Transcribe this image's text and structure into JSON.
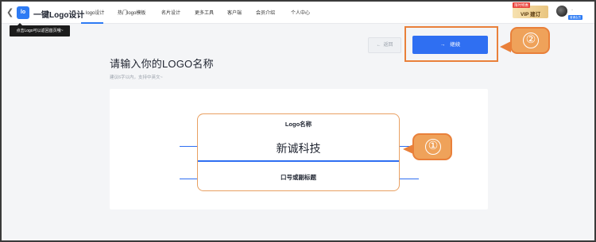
{
  "nav": {
    "brand": "一键Logo设计",
    "items": [
      "logo设计",
      "热门logo模板",
      "名片设计",
      "更多工具",
      "客户端",
      "会员介绍",
      "个人中心"
    ],
    "vip_tag": "限时特惠",
    "vip_label": "VIP 建订",
    "member_tag": "普通会员",
    "avatar_dot": "·",
    "logo_icon": "lo"
  },
  "tooltip": "点击Logo可以返回首页哦~",
  "actions": {
    "back": "返回",
    "continue": "继续",
    "arrow_left": "←",
    "arrow_right": "→"
  },
  "heading": "请输入你的LOGO名称",
  "subhint": "建议6字以内，支持中英文~",
  "form": {
    "name_label": "Logo名称",
    "name_value": "新诚科技",
    "slogan_placeholder": "口号或副标题"
  },
  "callouts": [
    "②",
    "①"
  ],
  "colors": {
    "accent": "#2f6ff2",
    "callout": "#e9803a",
    "tooltip_bg": "#1c1c1c"
  }
}
